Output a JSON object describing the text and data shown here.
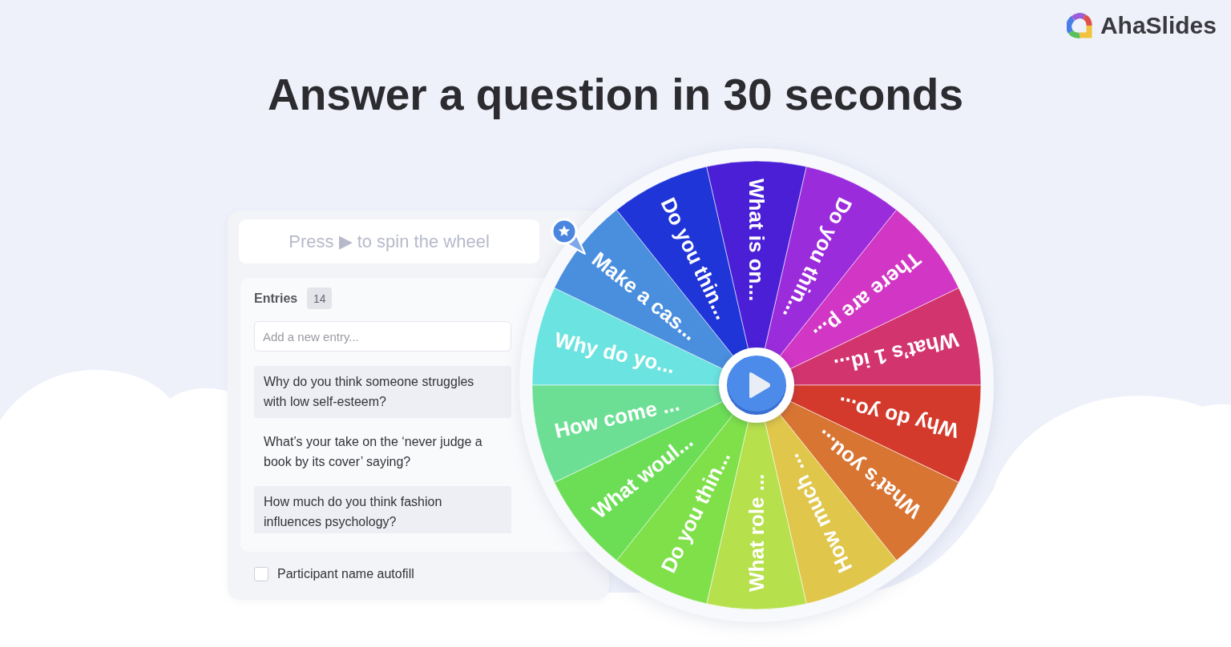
{
  "brand": {
    "name": "AhaSlides"
  },
  "headline": "Answer a question in 30 seconds",
  "spin_hint": "Press ▶ to spin the wheel",
  "entries_panel": {
    "title": "Entries",
    "count": "14",
    "new_entry": {
      "placeholder": "Add a new entry..."
    },
    "entries": [
      "Why do you think someone struggles with low self-esteem?",
      "What’s your take on the ‘never judge a book by its cover’ saying?",
      "How much do you think fashion influences psychology?"
    ],
    "autofill": {
      "label": "Participant name autofill",
      "checked": false
    }
  },
  "wheel": {
    "segments": [
      {
        "label": "Why do yo...",
        "color": "#6be3e0"
      },
      {
        "label": "Make a cas...",
        "color": "#4a8ede"
      },
      {
        "label": "Do you thin...",
        "color": "#2035d8"
      },
      {
        "label": "What is on...",
        "color": "#4a1fd6"
      },
      {
        "label": "Do you thin...",
        "color": "#9b2cdb"
      },
      {
        "label": "There are p...",
        "color": "#d236c4"
      },
      {
        "label": "What’s 1 id...",
        "color": "#d2346e"
      },
      {
        "label": "Why do yo...",
        "color": "#d33a2c"
      },
      {
        "label": "What’s you...",
        "color": "#d87533"
      },
      {
        "label": "How much ...",
        "color": "#e0c64a"
      },
      {
        "label": "What role ...",
        "color": "#b6e04c"
      },
      {
        "label": "Do you thin...",
        "color": "#7fe04a"
      },
      {
        "label": "What woul...",
        "color": "#6cde55"
      },
      {
        "label": "How come ...",
        "color": "#6ddf95"
      }
    ]
  }
}
